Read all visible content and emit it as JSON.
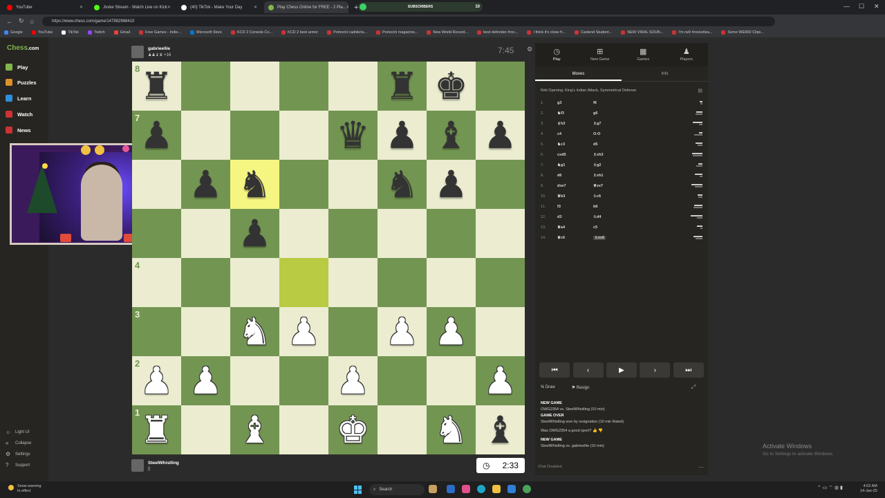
{
  "browser": {
    "tabs": [
      {
        "title": "YouTube",
        "color": "#ff0000"
      },
      {
        "title": "Jovke Stream - Watch Live on Kick",
        "color": "#53fc18"
      },
      {
        "title": "(40) TikTok - Make Your Day",
        "color": "#ffffff"
      },
      {
        "title": "Play Chess Online for FREE - 2 Pla...",
        "color": "#81b64c",
        "active": true
      }
    ],
    "new_tab": "+",
    "subscribers_label": "SUBSCRIBERS",
    "subscribers_count": "10",
    "url": "https://www.chess.com/game/147982968410",
    "bookmarks": [
      {
        "label": "Google",
        "color": "#4285f4"
      },
      {
        "label": "YouTube",
        "color": "#ff0000"
      },
      {
        "label": "TikTok",
        "color": "#ffffff"
      },
      {
        "label": "Twitch",
        "color": "#9146ff"
      },
      {
        "label": "Gmail",
        "color": "#ea4335"
      },
      {
        "label": "Free Games - Indie...",
        "color": "#cc3333"
      },
      {
        "label": "Microsoft Store",
        "color": "#0078d4"
      },
      {
        "label": "KCD 2 Console Co...",
        "color": "#cc3333"
      },
      {
        "label": "KCD 2 best armor",
        "color": "#cc3333"
      },
      {
        "label": "Pomoćni radnik/ra...",
        "color": "#cc3333"
      },
      {
        "label": "Pomoćni magacine...",
        "color": "#cc3333"
      },
      {
        "label": "New World Record...",
        "color": "#cc3333"
      },
      {
        "label": "best defender #roc...",
        "color": "#cc3333"
      },
      {
        "label": "I think it's close fr...",
        "color": "#cc3333"
      },
      {
        "label": "Caolend Student...",
        "color": "#cc3333"
      },
      {
        "label": "NEW VIRAL SOUN...",
        "color": "#cc3333"
      },
      {
        "label": "I'm rw9 #rocketlea...",
        "color": "#cc3333"
      },
      {
        "label": "Some WEIRD Clips...",
        "color": "#cc3333"
      }
    ]
  },
  "sidebar": {
    "logo_main": "Chess",
    "logo_suffix": ".com",
    "items": [
      {
        "label": "Play",
        "color": "#81b64c"
      },
      {
        "label": "Puzzles",
        "color": "#e0902a"
      },
      {
        "label": "Learn",
        "color": "#2f8fdc"
      },
      {
        "label": "Watch",
        "color": "#cc3333"
      },
      {
        "label": "News",
        "color": "#cc3333"
      }
    ],
    "bottom": [
      {
        "label": "Light UI",
        "icon": "sun-icon"
      },
      {
        "label": "Collapse",
        "icon": "collapse-icon"
      },
      {
        "label": "Settings",
        "icon": "gear-icon"
      },
      {
        "label": "Support",
        "icon": "help-icon"
      }
    ]
  },
  "game": {
    "top_player": {
      "name": "gabrieellie",
      "captured": "♟♟♝♛ +16"
    },
    "top_clock": "7:45",
    "bottom_player": {
      "name": "SteelWhistling",
      "captured": "||"
    },
    "bottom_clock": "2:33",
    "ranks": [
      "8",
      "7",
      "",
      "",
      "4",
      "3",
      "2",
      "1"
    ],
    "files": [
      "a",
      "b",
      "c",
      "d",
      "e",
      "f",
      "g",
      "h"
    ],
    "position": [
      [
        "br",
        "",
        "",
        "",
        "",
        "br",
        "bk",
        ""
      ],
      [
        "bp",
        "",
        "",
        "",
        "bq",
        "bp",
        "bb",
        "bp"
      ],
      [
        "",
        "bp",
        "bn",
        "",
        "",
        "bn",
        "bp",
        ""
      ],
      [
        "",
        "",
        "bp",
        "",
        "",
        "",
        "",
        ""
      ],
      [
        "",
        "",
        "",
        "",
        "",
        "",
        "",
        ""
      ],
      [
        "",
        "",
        "wn",
        "wp",
        "",
        "wp",
        "wp",
        ""
      ],
      [
        "wp",
        "wp",
        "",
        "",
        "wp",
        "",
        "",
        "wp"
      ],
      [
        "wr",
        "",
        "wb",
        "",
        "wk",
        "",
        "wn",
        "bb"
      ]
    ],
    "highlights": [
      {
        "sq": "c6",
        "color": "#f5f682"
      },
      {
        "sq": "d4",
        "color": "#b9ca43"
      }
    ]
  },
  "panel": {
    "tabs": [
      {
        "label": "Play",
        "icon": "stopwatch-icon",
        "active": true
      },
      {
        "label": "New Game",
        "icon": "plus-icon"
      },
      {
        "label": "Games",
        "icon": "games-icon"
      },
      {
        "label": "Players",
        "icon": "players-icon"
      }
    ],
    "subtabs": [
      {
        "label": "Moves",
        "active": true
      },
      {
        "label": "Info"
      }
    ],
    "opening": "Réti Opening: King's Indian Attack, Symmetrical Defense",
    "moves": [
      {
        "n": "1.",
        "w": "g3",
        "b": "f6"
      },
      {
        "n": "2.",
        "w": "♞f3",
        "b": "g6"
      },
      {
        "n": "3.",
        "w": "♝h3",
        "b": "♗g7"
      },
      {
        "n": "4.",
        "w": "c4",
        "b": "O-O"
      },
      {
        "n": "5.",
        "w": "♞c3",
        "b": "d5"
      },
      {
        "n": "6.",
        "w": "cxd5",
        "b": "♗xh3"
      },
      {
        "n": "7.",
        "w": "♞g1",
        "b": "♗g2"
      },
      {
        "n": "8.",
        "w": "d6",
        "b": "♗xh1"
      },
      {
        "n": "9.",
        "w": "dxe7",
        "b": "♕xe7"
      },
      {
        "n": "10.",
        "w": "♛b3",
        "b": "♘c6"
      },
      {
        "n": "11.",
        "w": "f3",
        "b": "b6"
      },
      {
        "n": "12.",
        "w": "d3",
        "b": "♘d4"
      },
      {
        "n": "13.",
        "w": "♛a4",
        "b": "c5"
      },
      {
        "n": "14.",
        "w": "♛c6",
        "b": "♘xc6"
      }
    ],
    "controls": [
      "⏮",
      "‹",
      "▶",
      "›",
      "⏭"
    ],
    "draw_label": "Draw",
    "resign_label": "Resign",
    "chat": [
      {
        "head": "NEW GAME",
        "text": "OWG2354 vs. SteelWhistling (10 min)"
      },
      {
        "head": "GAME OVER",
        "text": "SteelWhistling won by resignation (10 min Rated)"
      },
      {
        "head": "",
        "text": "Was OWG2354 a good sport?"
      },
      {
        "head": "NEW GAME",
        "text": "SteelWhistling vs. gabrieellie (10 min)"
      }
    ],
    "chat_disabled": "Chat Disabled"
  },
  "windows": {
    "activate_title": "Activate Windows",
    "activate_sub": "Go to Settings to activate Windows.",
    "weather_line1": "Snow warning",
    "weather_line2": "In effect",
    "search_label": "Search",
    "time": "4:02 AM",
    "date": "14-Jan-25"
  },
  "colors": {
    "board_light": "#ebecd0",
    "board_dark": "#739552",
    "accent": "#81b64c"
  }
}
